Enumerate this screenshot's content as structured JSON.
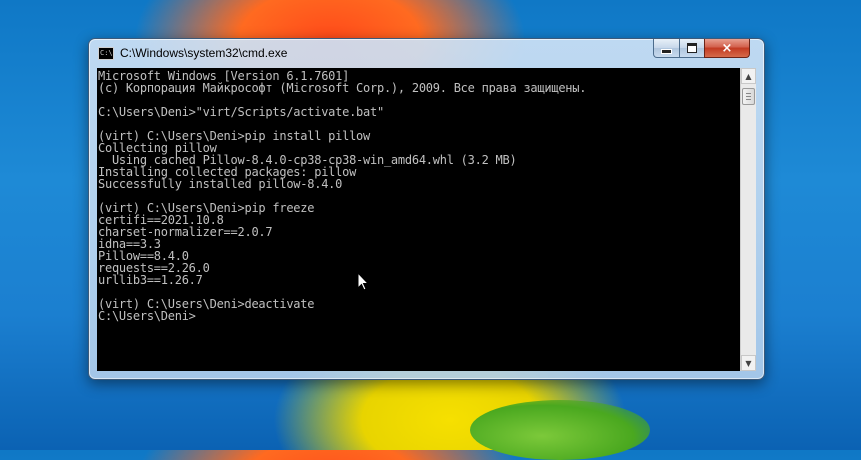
{
  "window": {
    "title": "C:\\Windows\\system32\\cmd.exe",
    "icon": "console-icon",
    "controls": {
      "minimize": "minimize-icon",
      "maximize": "maximize-icon",
      "close": "×"
    }
  },
  "console": {
    "lines": [
      "Microsoft Windows [Version 6.1.7601]",
      "(c) Корпорация Майкрософт (Microsoft Corp.), 2009. Все права защищены.",
      "",
      "C:\\Users\\Deni>\"virt/Scripts/activate.bat\"",
      "",
      "(virt) C:\\Users\\Deni>pip install pillow",
      "Collecting pillow",
      "  Using cached Pillow-8.4.0-cp38-cp38-win_amd64.whl (3.2 MB)",
      "Installing collected packages: pillow",
      "Successfully installed pillow-8.4.0",
      "",
      "(virt) C:\\Users\\Deni>pip freeze",
      "certifi==2021.10.8",
      "charset-normalizer==2.0.7",
      "idna==3.3",
      "Pillow==8.4.0",
      "requests==2.26.0",
      "urllib3==1.26.7",
      "",
      "(virt) C:\\Users\\Deni>deactivate",
      "C:\\Users\\Deni>"
    ]
  },
  "scrollbar": {
    "up": "▲",
    "down": "▼"
  },
  "colors": {
    "console_bg": "#000000",
    "console_fg": "#c0c0c0",
    "close_button": "#c23a22"
  }
}
